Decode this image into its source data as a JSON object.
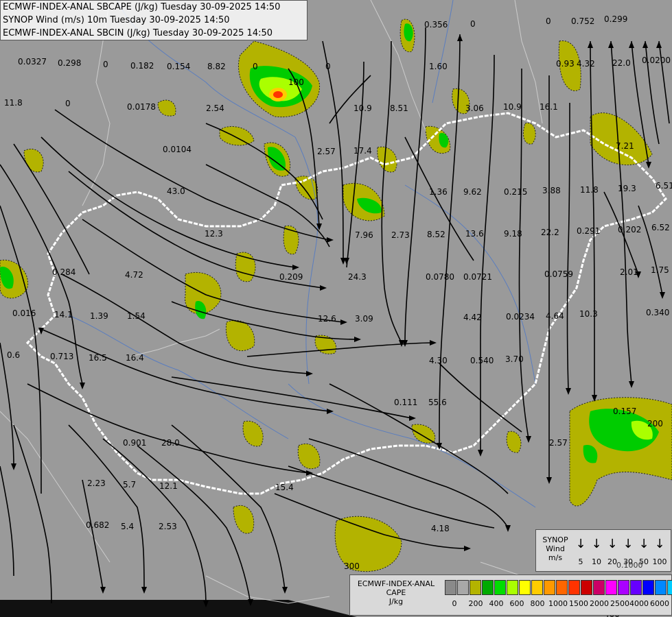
{
  "header": {
    "line1": "ECMWF-INDEX-ANAL SBCAPE (J/kg) Tuesday 30-09-2025 14:50",
    "line2": "SYNOP Wind (m/s) 10m Tuesday 30-09-2025 14:50",
    "line3": "ECMWF-INDEX-ANAL SBCIN (J/kg) Tuesday 30-09-2025 14:50"
  },
  "map_values": [
    "0.0327",
    "0.298",
    "0",
    "0.182",
    "0.154",
    "8.82",
    "0",
    "0",
    "0.356",
    "0",
    "0",
    "0.752",
    "0.299",
    "11.8",
    "0",
    "0.0178",
    "2.54",
    "10.9",
    "8.51",
    "1.60",
    "3.06",
    "10.9",
    "16.1",
    "0.93",
    "4.32",
    "22.0",
    "0.0200",
    "0.0104",
    "2.57",
    "17.4",
    "7.21",
    "43.0",
    "1.36",
    "9.62",
    "0.215",
    "3.88",
    "11.8",
    "19.3",
    "6.51",
    "12.3",
    "7.96",
    "2.73",
    "8.52",
    "13.6",
    "9.18",
    "22.2",
    "0.291",
    "0.202",
    "6.52",
    "0.284",
    "4.72",
    "0.209",
    "24.3",
    "0.0780",
    "0.0721",
    "0.0759",
    "2.01",
    "1.75",
    "0.016",
    "14.1",
    "1.39",
    "1.54",
    "12.6",
    "3.09",
    "4.42",
    "0.0234",
    "4.64",
    "10.3",
    "0.340",
    "0.6",
    "0.713",
    "16.5",
    "16.4",
    "4.30",
    "0.540",
    "3.70",
    "0.111",
    "55.6",
    "0.901",
    "28.0",
    "2.57",
    "2.23",
    "5.7",
    "12.1",
    "15.4",
    "0.682",
    "5.4",
    "2.53",
    "4.18",
    "0.157",
    "200",
    "300",
    "100",
    "400",
    "0"
  ],
  "colors": {
    "background": "#9a9a9a",
    "border": "#ffffff",
    "streamline": "#000000",
    "cape_low": "#aaaa00",
    "cape_mid": "#00cc00",
    "cape_high": "#ff3300"
  },
  "wind_legend": {
    "title_line1": "SYNOP",
    "title_line2": "Wind",
    "unit": "m/s",
    "speeds": [
      "5",
      "10",
      "20",
      "30",
      "50",
      "100"
    ]
  },
  "cape_legend": {
    "title_line1": "ECMWF-INDEX-ANAL",
    "title_line2": "CAPE",
    "unit": "J/kg",
    "swatch_colors": [
      "#8a8a8a",
      "#a8a8a8",
      "#b3b300",
      "#00aa00",
      "#00dd00",
      "#aaff00",
      "#ffff00",
      "#ffcc00",
      "#ff9900",
      "#ff6600",
      "#ff3300",
      "#cc0000",
      "#cc0066",
      "#ff00ff",
      "#aa00ff",
      "#6600ff",
      "#0000ff",
      "#0088ff",
      "#00ccff",
      "#00ffff",
      "#ffffff"
    ],
    "labels": [
      "0",
      "200",
      "400",
      "600",
      "800",
      "1000",
      "1500",
      "2000",
      "2500",
      "4000",
      "6000"
    ]
  },
  "overlay_text": [
    "0.1000"
  ]
}
